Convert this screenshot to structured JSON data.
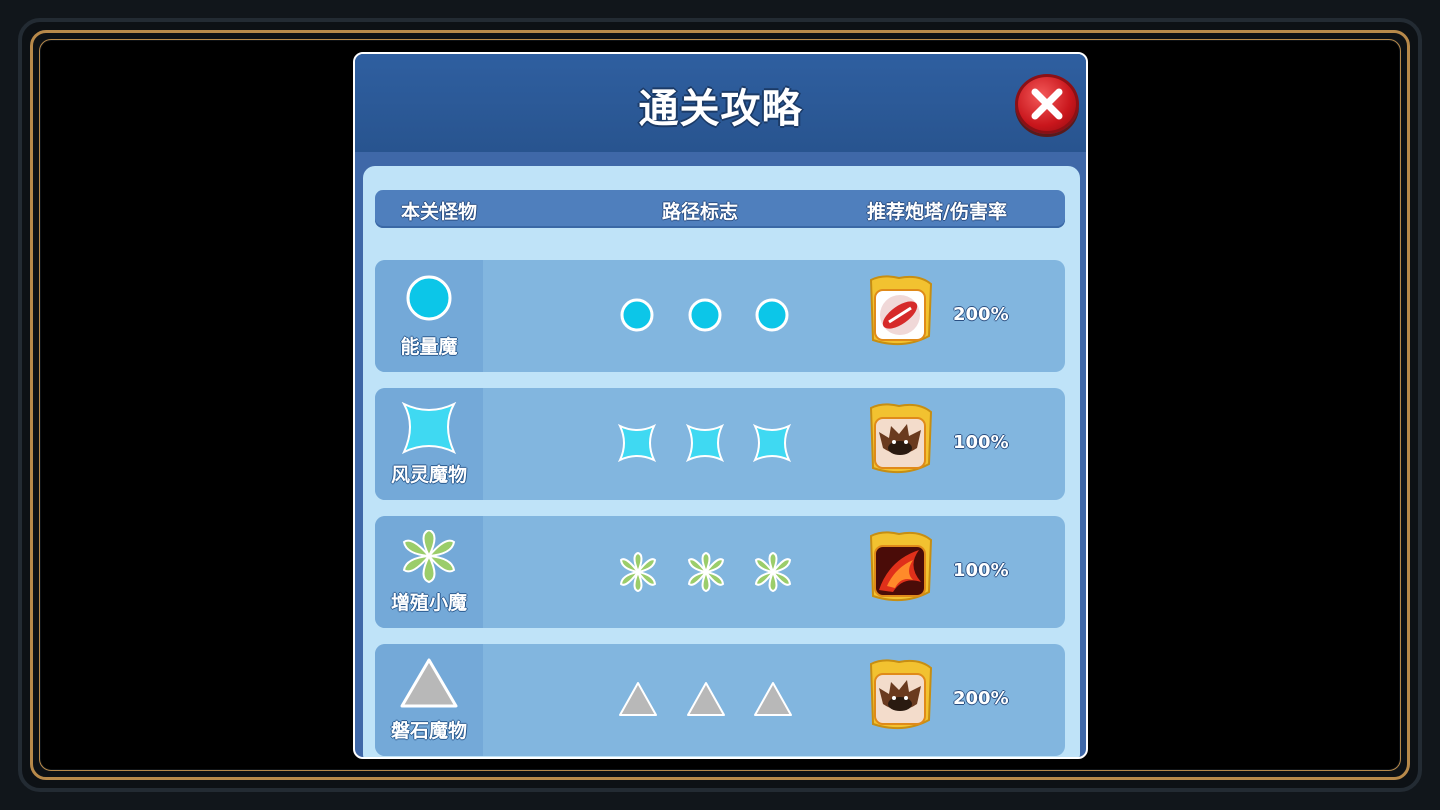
{
  "dialog": {
    "title": "通关攻略"
  },
  "table": {
    "headers": {
      "monster": "本关怪物",
      "path": "路径标志",
      "tower": "推荐炮塔/伤害率"
    },
    "rows": [
      {
        "monster_name": "能量魔",
        "shape": "circle",
        "tower_icon": "red-bottle-tower-icon",
        "rate": "200%"
      },
      {
        "monster_name": "风灵魔物",
        "shape": "four-point-star",
        "tower_icon": "dark-beast-tower-icon",
        "rate": "100%"
      },
      {
        "monster_name": "增殖小魔",
        "shape": "clover",
        "tower_icon": "fire-tower-icon",
        "rate": "100%"
      },
      {
        "monster_name": "磐石魔物",
        "shape": "triangle",
        "tower_icon": "dark-beast-tower-icon",
        "rate": "200%"
      }
    ]
  },
  "colors": {
    "circle": "#0cc6e8",
    "star": "#3fd9f2",
    "clover": "#9bcd6a",
    "triangle": "#b8b8b8",
    "gold": "#f2c230"
  }
}
